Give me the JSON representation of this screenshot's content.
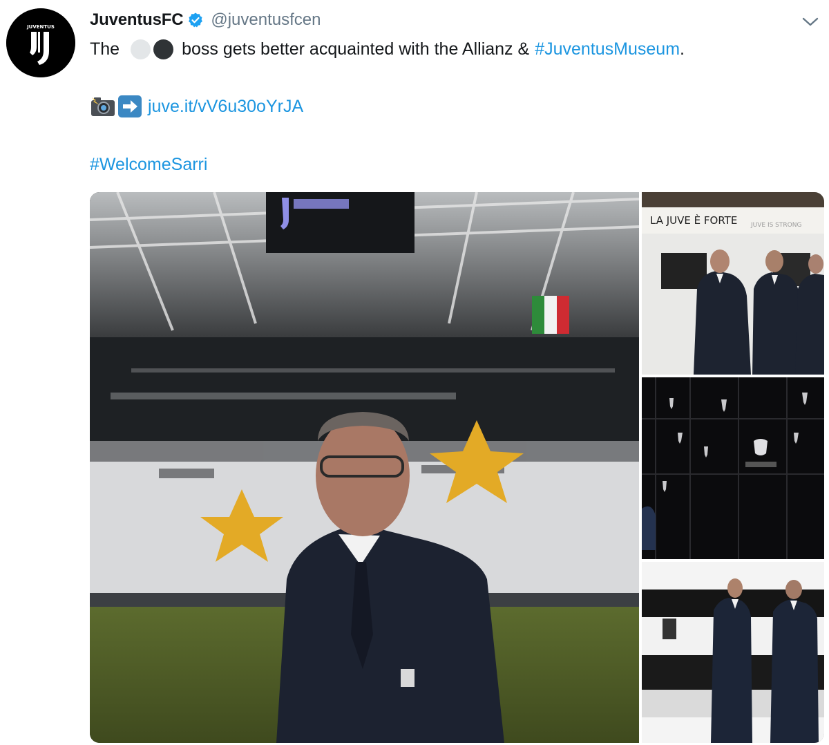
{
  "tweet": {
    "author": {
      "display_name": "JuventusFC",
      "handle": "@juventusfcen",
      "verified": true,
      "avatar_icon": "juventus-logo-icon"
    },
    "text": {
      "prefix": "The",
      "emoji": [
        "white-circle",
        "black-circle"
      ],
      "middle": "boss gets better acquainted with the Allianz &",
      "hashtag_museum": "#JuventusMuseum",
      "suffix": "."
    },
    "link_line": {
      "emoji": [
        "camera-with-flash-icon",
        "right-arrow-icon"
      ],
      "url": "juve.it/vV6u30oYrJA"
    },
    "hashtag_line": "#WelcomeSarri",
    "menu_icon": "chevron-down-icon",
    "media": {
      "photos": [
        {
          "name": "stadium-photo"
        },
        {
          "name": "museum-wall-photo",
          "sign_text": "LA JUVE È FORTE",
          "sign_sub": "JUVE IS STRONG"
        },
        {
          "name": "trophy-room-photo"
        },
        {
          "name": "museum-corridor-photo"
        }
      ]
    },
    "colors": {
      "link": "#1b95e0",
      "text": "#14171a",
      "muted": "#657786",
      "verified": "#1da1f2"
    }
  }
}
